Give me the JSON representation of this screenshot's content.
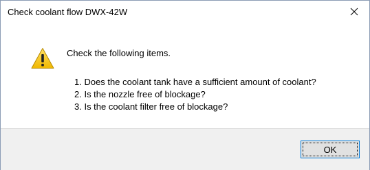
{
  "window": {
    "title": "Check coolant flow DWX-42W",
    "close_icon": "close-icon"
  },
  "message": {
    "icon": "warning-icon",
    "heading": "Check the following items.",
    "items": [
      "1. Does the coolant tank have a sufficient amount of coolant?",
      "2. Is the nozzle free of blockage?",
      "3. Is the coolant filter free of blockage?"
    ]
  },
  "buttons": {
    "ok_label": "OK"
  },
  "colors": {
    "accent": "#0078d7",
    "warning_yellow": "#f5c400",
    "footer_bg": "#f0f0f0"
  }
}
